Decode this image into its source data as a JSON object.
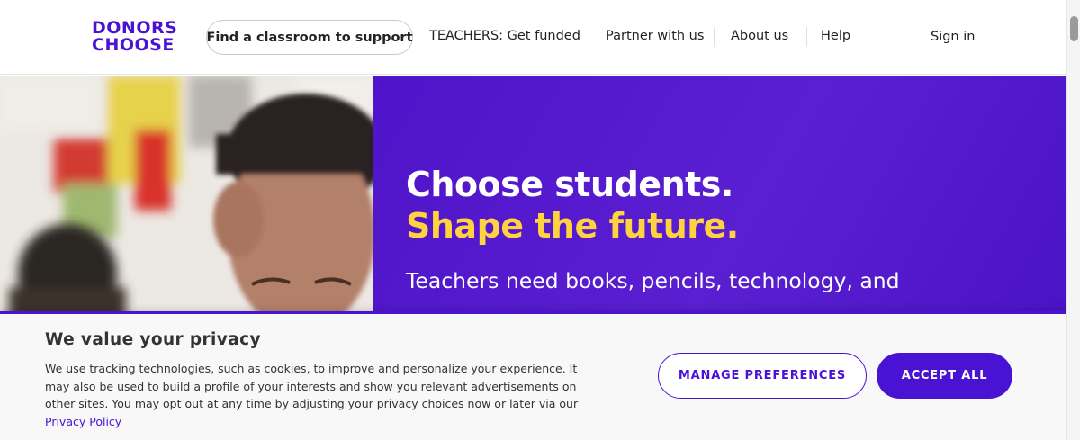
{
  "header": {
    "logo_line1": "DONORS",
    "logo_line2": "CHOOSE",
    "find_button": "Find a classroom to support",
    "nav": {
      "teachers": "TEACHERS: Get funded",
      "partner": "Partner with us",
      "about": "About us",
      "help": "Help"
    },
    "sign_in": "Sign in"
  },
  "hero": {
    "headline": "Choose students.",
    "headline_accent": "Shape the future.",
    "subtext": "Teachers need books, pencils, technology, and"
  },
  "cookie_banner": {
    "title": "We value your privacy",
    "body": "We use tracking technologies, such as cookies, to improve and personalize your experience. It may also be used to build a profile of your interests and show you relevant advertisements on other sites. You may opt out at any time by adjusting your privacy choices now or later via our",
    "privacy_link": "Privacy Policy",
    "manage_button": "MANAGE PREFERENCES",
    "accept_button": "ACCEPT ALL"
  },
  "colors": {
    "brand_purple": "#4a13d3",
    "accent_yellow": "#ffd23f"
  }
}
